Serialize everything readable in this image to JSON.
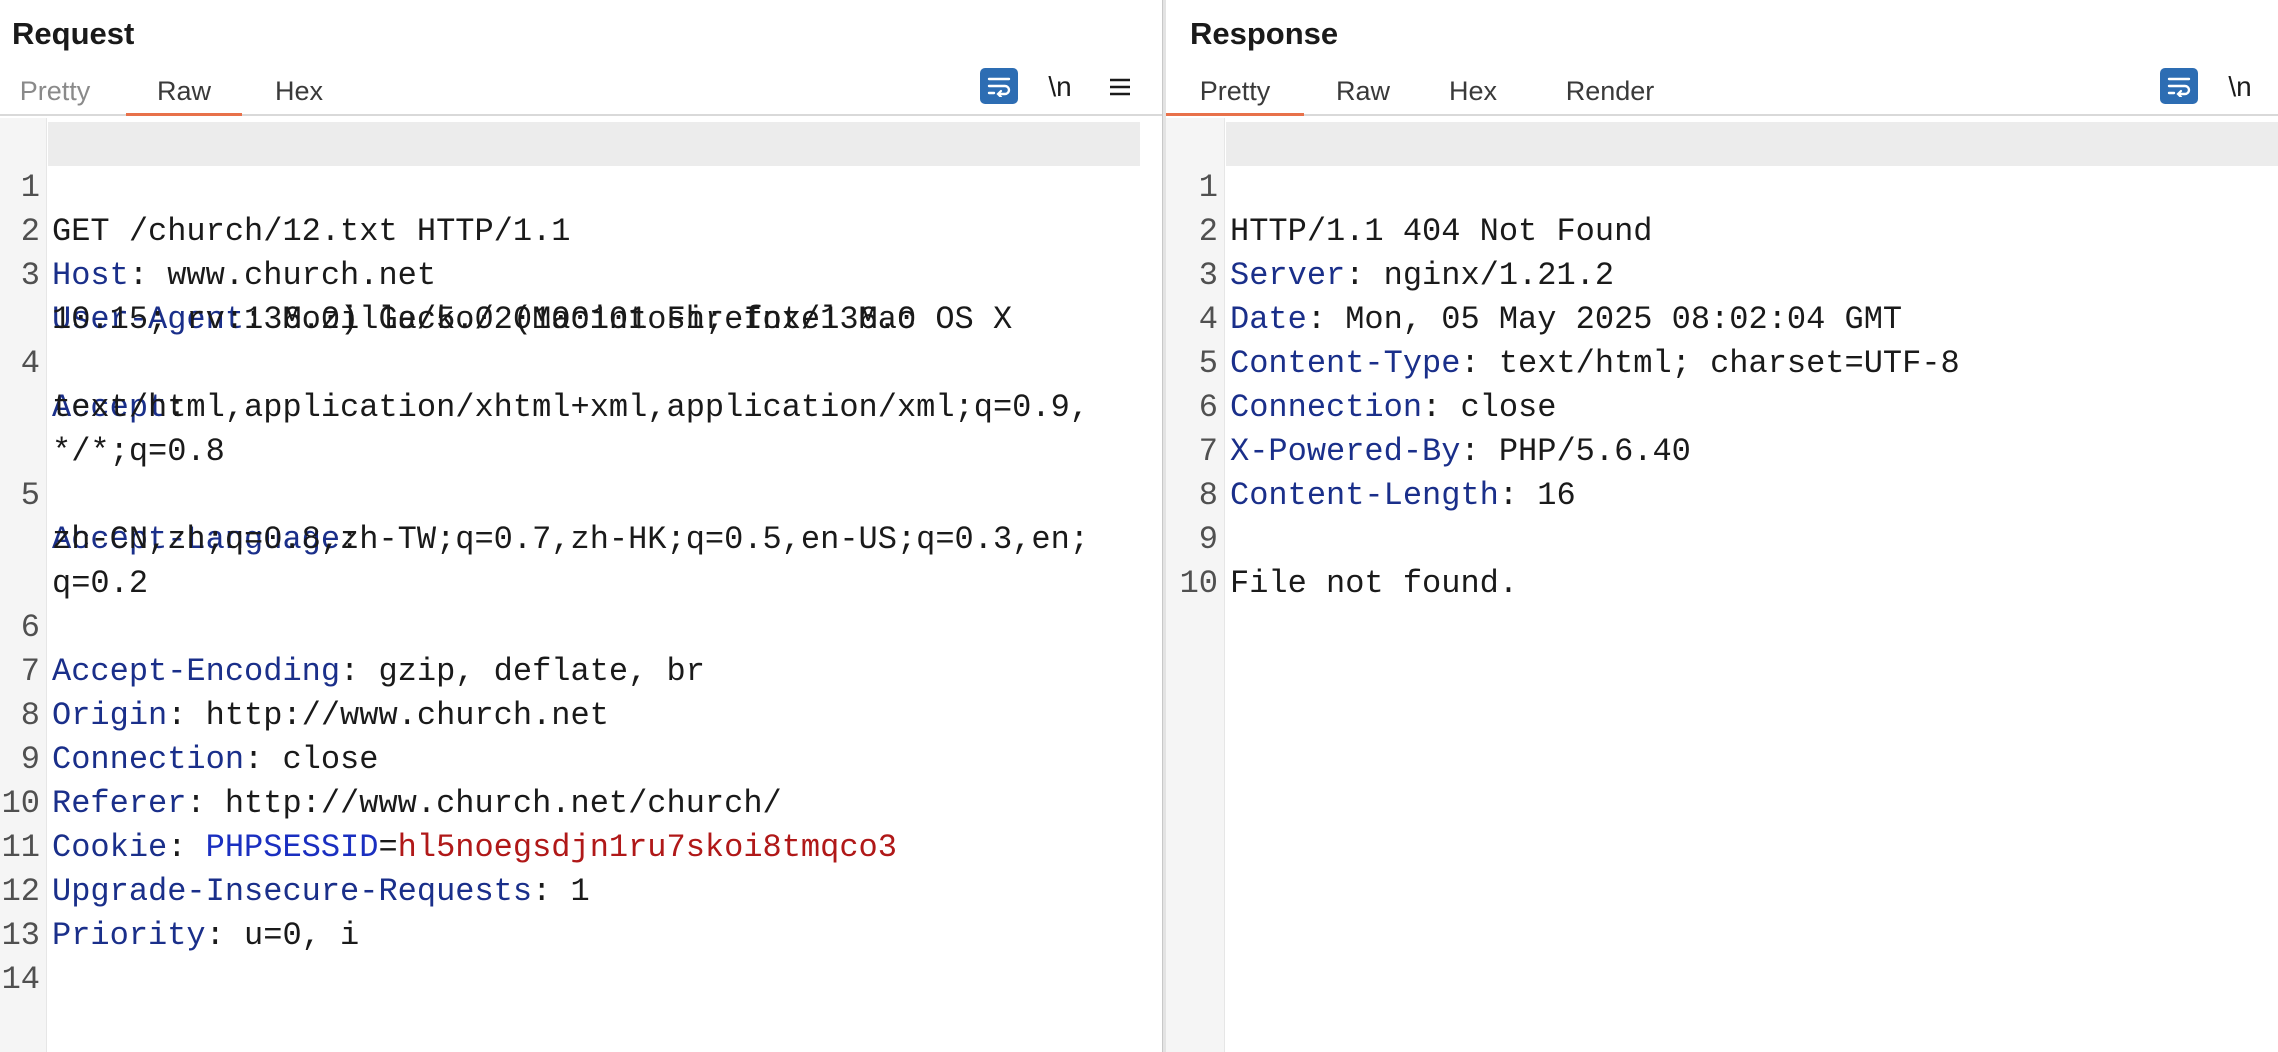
{
  "request": {
    "title": "Request",
    "tabs": [
      "Pretty",
      "Raw",
      "Hex"
    ],
    "active_tab": "Raw",
    "newline_label": "\\n",
    "line_numbers": [
      "1",
      "2",
      "3",
      "",
      "4",
      "",
      "",
      "5",
      "",
      "",
      "6",
      "7",
      "8",
      "9",
      "10",
      "11",
      "12",
      "13",
      "14"
    ],
    "lines": [
      {
        "ln": "1",
        "key": "",
        "sep": "",
        "val": "GET /church/12.txt HTTP/1.1"
      },
      {
        "ln": "2",
        "key": "Host",
        "sep": ": ",
        "val": "www.church.net"
      },
      {
        "ln": "3",
        "key": "User-Agent",
        "sep": ": ",
        "val": "Mozilla/5.0 (Macintosh; Intel Mac OS X"
      },
      {
        "ln": "",
        "key": "",
        "sep": "",
        "val": "10.15; rv:136.0) Gecko/20100101 Firefox/136.0"
      },
      {
        "ln": "4",
        "key": "Accept",
        "sep": ":",
        "val": ""
      },
      {
        "ln": "",
        "key": "",
        "sep": "",
        "val": "text/html,application/xhtml+xml,application/xml;q=0.9,"
      },
      {
        "ln": "",
        "key": "",
        "sep": "",
        "val": "*/*;q=0.8"
      },
      {
        "ln": "5",
        "key": "Accept-Language",
        "sep": ":",
        "val": ""
      },
      {
        "ln": "",
        "key": "",
        "sep": "",
        "val": "zh-CN,zh;q=0.8,zh-TW;q=0.7,zh-HK;q=0.5,en-US;q=0.3,en;"
      },
      {
        "ln": "",
        "key": "",
        "sep": "",
        "val": "q=0.2"
      },
      {
        "ln": "6",
        "key": "Accept-Encoding",
        "sep": ": ",
        "val": "gzip, deflate, br"
      },
      {
        "ln": "7",
        "key": "Origin",
        "sep": ": ",
        "val": "http://www.church.net"
      },
      {
        "ln": "8",
        "key": "Connection",
        "sep": ": ",
        "val": "close"
      },
      {
        "ln": "9",
        "key": "Referer",
        "sep": ": ",
        "val": "http://www.church.net/church/"
      },
      {
        "ln": "10",
        "key": "Cookie",
        "sep": ": ",
        "cookie_name": "PHPSESSID",
        "cookie_eq": "=",
        "cookie_val": "hl5noegsdjn1ru7skoi8tmqco3",
        "val": ""
      },
      {
        "ln": "11",
        "key": "Upgrade-Insecure-Requests",
        "sep": ": ",
        "val": "1"
      },
      {
        "ln": "12",
        "key": "Priority",
        "sep": ": ",
        "val": "u=0, i"
      },
      {
        "ln": "13",
        "key": "",
        "sep": "",
        "val": ""
      },
      {
        "ln": "14",
        "key": "",
        "sep": "",
        "val": ""
      }
    ]
  },
  "response": {
    "title": "Response",
    "tabs": [
      "Pretty",
      "Raw",
      "Hex",
      "Render"
    ],
    "active_tab": "Pretty",
    "newline_label": "\\n",
    "lines": [
      {
        "ln": "1",
        "key": "",
        "sep": "",
        "val": "HTTP/1.1 404 Not Found"
      },
      {
        "ln": "2",
        "key": "Server",
        "sep": ": ",
        "val": "nginx/1.21.2"
      },
      {
        "ln": "3",
        "key": "Date",
        "sep": ": ",
        "val": "Mon, 05 May 2025 08:02:04 GMT"
      },
      {
        "ln": "4",
        "key": "Content-Type",
        "sep": ": ",
        "val": "text/html; charset=UTF-8"
      },
      {
        "ln": "5",
        "key": "Connection",
        "sep": ": ",
        "val": "close"
      },
      {
        "ln": "6",
        "key": "X-Powered-By",
        "sep": ": ",
        "val": "PHP/5.6.40"
      },
      {
        "ln": "7",
        "key": "Content-Length",
        "sep": ": ",
        "val": "16"
      },
      {
        "ln": "8",
        "key": "",
        "sep": "",
        "val": ""
      },
      {
        "ln": "9",
        "key": "",
        "sep": "",
        "val": "File not found."
      },
      {
        "ln": "10",
        "key": "",
        "sep": "",
        "val": ""
      }
    ]
  },
  "colors": {
    "accent_tab": "#e8714a",
    "header_key": "#1a2f8a",
    "cookie_value": "#b01818",
    "button_blue": "#2d6db3"
  },
  "icons": {
    "wrap": "text-wrap-icon",
    "menu": "hamburger-menu-icon"
  }
}
